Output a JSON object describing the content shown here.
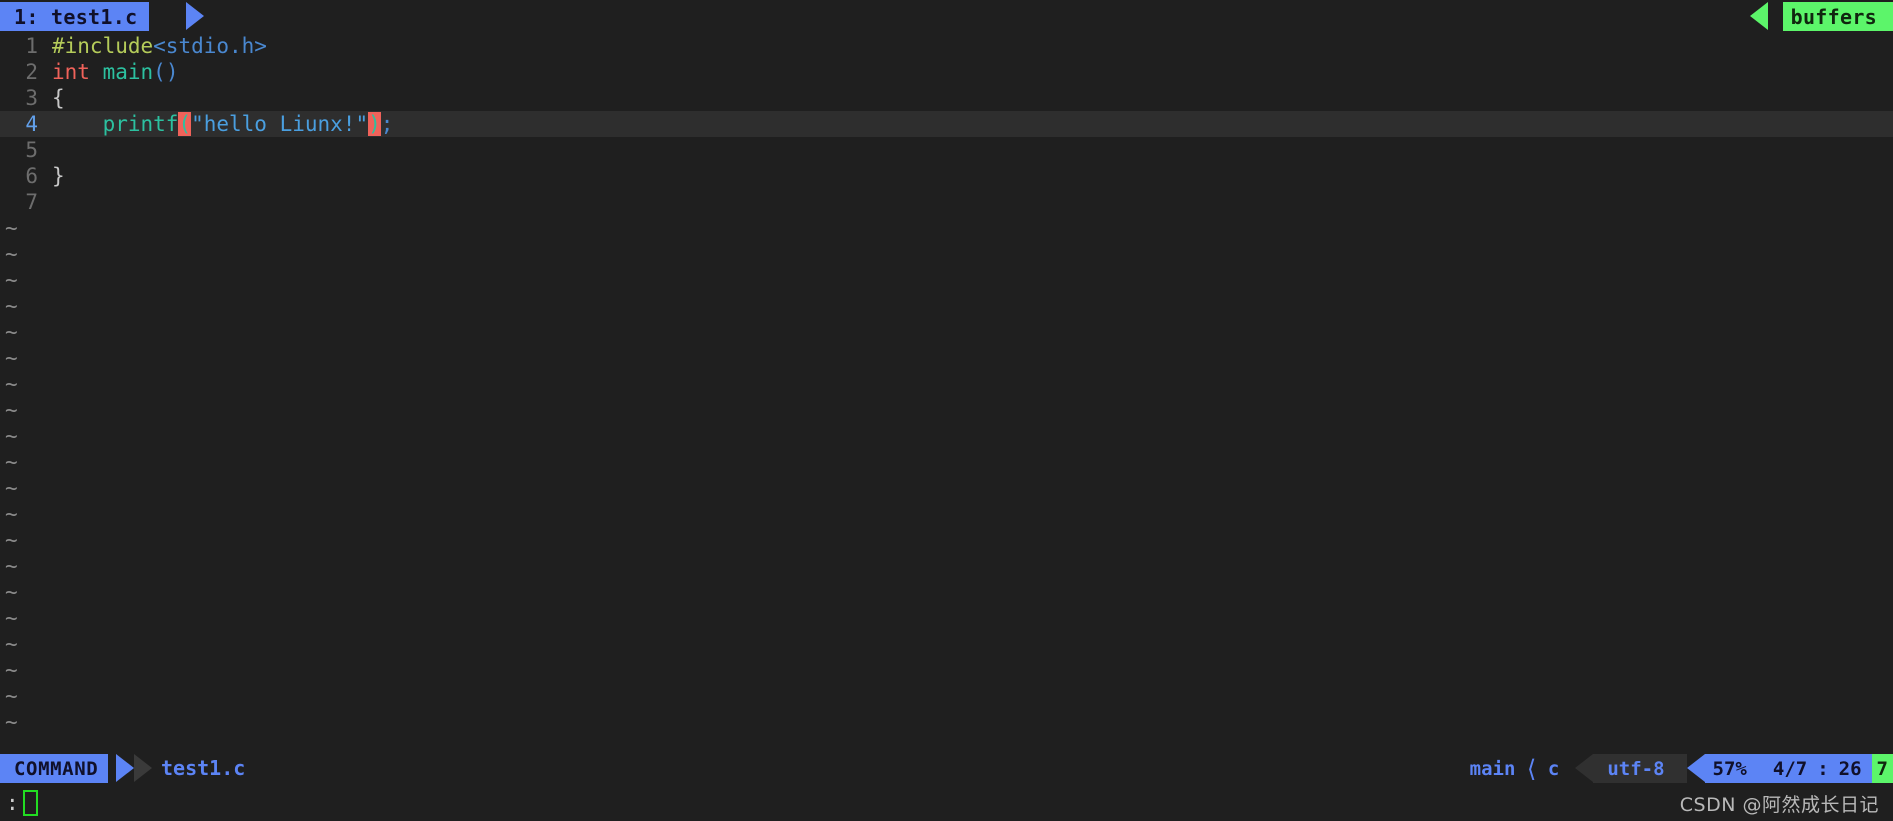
{
  "colors": {
    "background": "#1f1f1f",
    "accent_blue": "#5c84f5",
    "accent_green": "#5cf56a",
    "current_line": "#2e2e2e",
    "match_paren": "#f0625a",
    "line_number": "#6d6d6d",
    "line_number_current": "#62a0ea"
  },
  "tabline": {
    "tab_label": "1: test1.c",
    "buffers_label": "buffers"
  },
  "editor": {
    "lines": [
      {
        "num": "1",
        "current": false,
        "tokens": [
          {
            "text": "#include",
            "kind": "preproc"
          },
          {
            "text": "<stdio.h>",
            "kind": "header"
          }
        ]
      },
      {
        "num": "2",
        "current": false,
        "tokens": [
          {
            "text": "int",
            "kind": "type"
          },
          {
            "text": " ",
            "kind": "plain"
          },
          {
            "text": "main",
            "kind": "func"
          },
          {
            "text": "()",
            "kind": "punct"
          }
        ]
      },
      {
        "num": "3",
        "current": false,
        "tokens": [
          {
            "text": "{",
            "kind": "plain"
          }
        ]
      },
      {
        "num": "4",
        "current": true,
        "tokens": [
          {
            "text": "    ",
            "kind": "plain"
          },
          {
            "text": "printf",
            "kind": "func"
          },
          {
            "text": "(",
            "kind": "match"
          },
          {
            "text": "\"hello Liunx!\"",
            "kind": "string"
          },
          {
            "text": ")",
            "kind": "match"
          },
          {
            "text": ";",
            "kind": "punct"
          }
        ]
      },
      {
        "num": "5",
        "current": false,
        "tokens": []
      },
      {
        "num": "6",
        "current": false,
        "tokens": [
          {
            "text": "}",
            "kind": "plain"
          }
        ]
      },
      {
        "num": "7",
        "current": false,
        "tokens": []
      }
    ],
    "filler_symbol": "~",
    "filler_count": 20
  },
  "statusline": {
    "mode": "COMMAND",
    "filename": "test1.c",
    "branch": "main",
    "branch_separator_icon": "chevron-left-icon",
    "filetype": "c",
    "encoding": "utf-8",
    "percent": "57%",
    "line_of_total": "4/7",
    "colon": ":",
    "column": "26",
    "total_lines": "7"
  },
  "cmdline": {
    "prompt": ":",
    "input_value": ""
  },
  "watermark": {
    "text": "CSDN @阿然成长日记"
  }
}
